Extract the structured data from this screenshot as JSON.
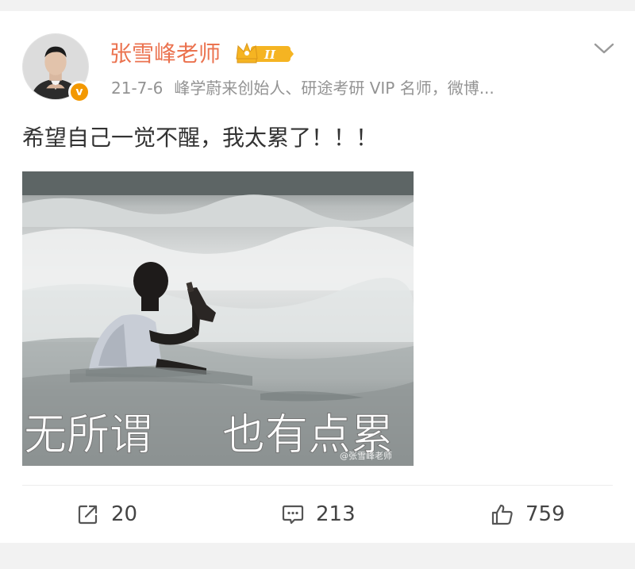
{
  "post": {
    "username": "张雪峰老师",
    "vip_level": "II",
    "verified_mark": "v",
    "date": "21-7-6",
    "bio": "峰学蔚来创始人、研途考研 VIP 名师，微博...",
    "text": "希望自己一觉不醒，我太累了！！！",
    "image": {
      "caption_left": "无所谓",
      "caption_right": "也有点累",
      "watermark": "@张雪峰老师"
    }
  },
  "actions": {
    "repost_count": "20",
    "comment_count": "213",
    "like_count": "759"
  },
  "icons": {
    "repost": "share-icon",
    "comment": "comment-icon",
    "like": "thumbs-up-icon",
    "dropdown": "chevron-down-icon",
    "vip": "crown-icon"
  },
  "colors": {
    "username": "#eb7350",
    "meta": "#939393",
    "text": "#333333",
    "verified": "#f39800",
    "vip_gold": "#f5b422"
  }
}
